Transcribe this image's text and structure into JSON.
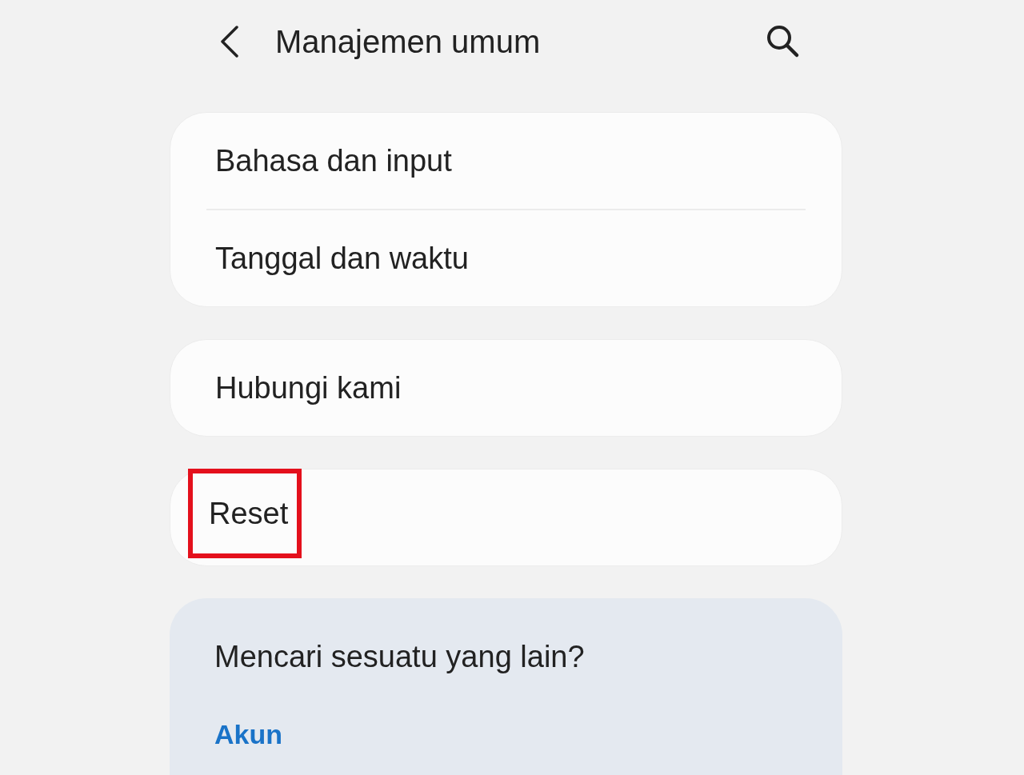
{
  "header": {
    "title": "Manajemen umum"
  },
  "groups": [
    {
      "kind": "card",
      "items": [
        {
          "label": "Bahasa dan input",
          "highlighted": false
        },
        {
          "label": "Tanggal dan waktu",
          "highlighted": false
        }
      ]
    },
    {
      "kind": "card",
      "items": [
        {
          "label": "Hubungi kami",
          "highlighted": false
        }
      ]
    },
    {
      "kind": "card",
      "items": [
        {
          "label": "Reset",
          "highlighted": true
        }
      ]
    }
  ],
  "suggestions": {
    "title": "Mencari sesuatu yang lain?",
    "links": [
      "Akun"
    ]
  }
}
